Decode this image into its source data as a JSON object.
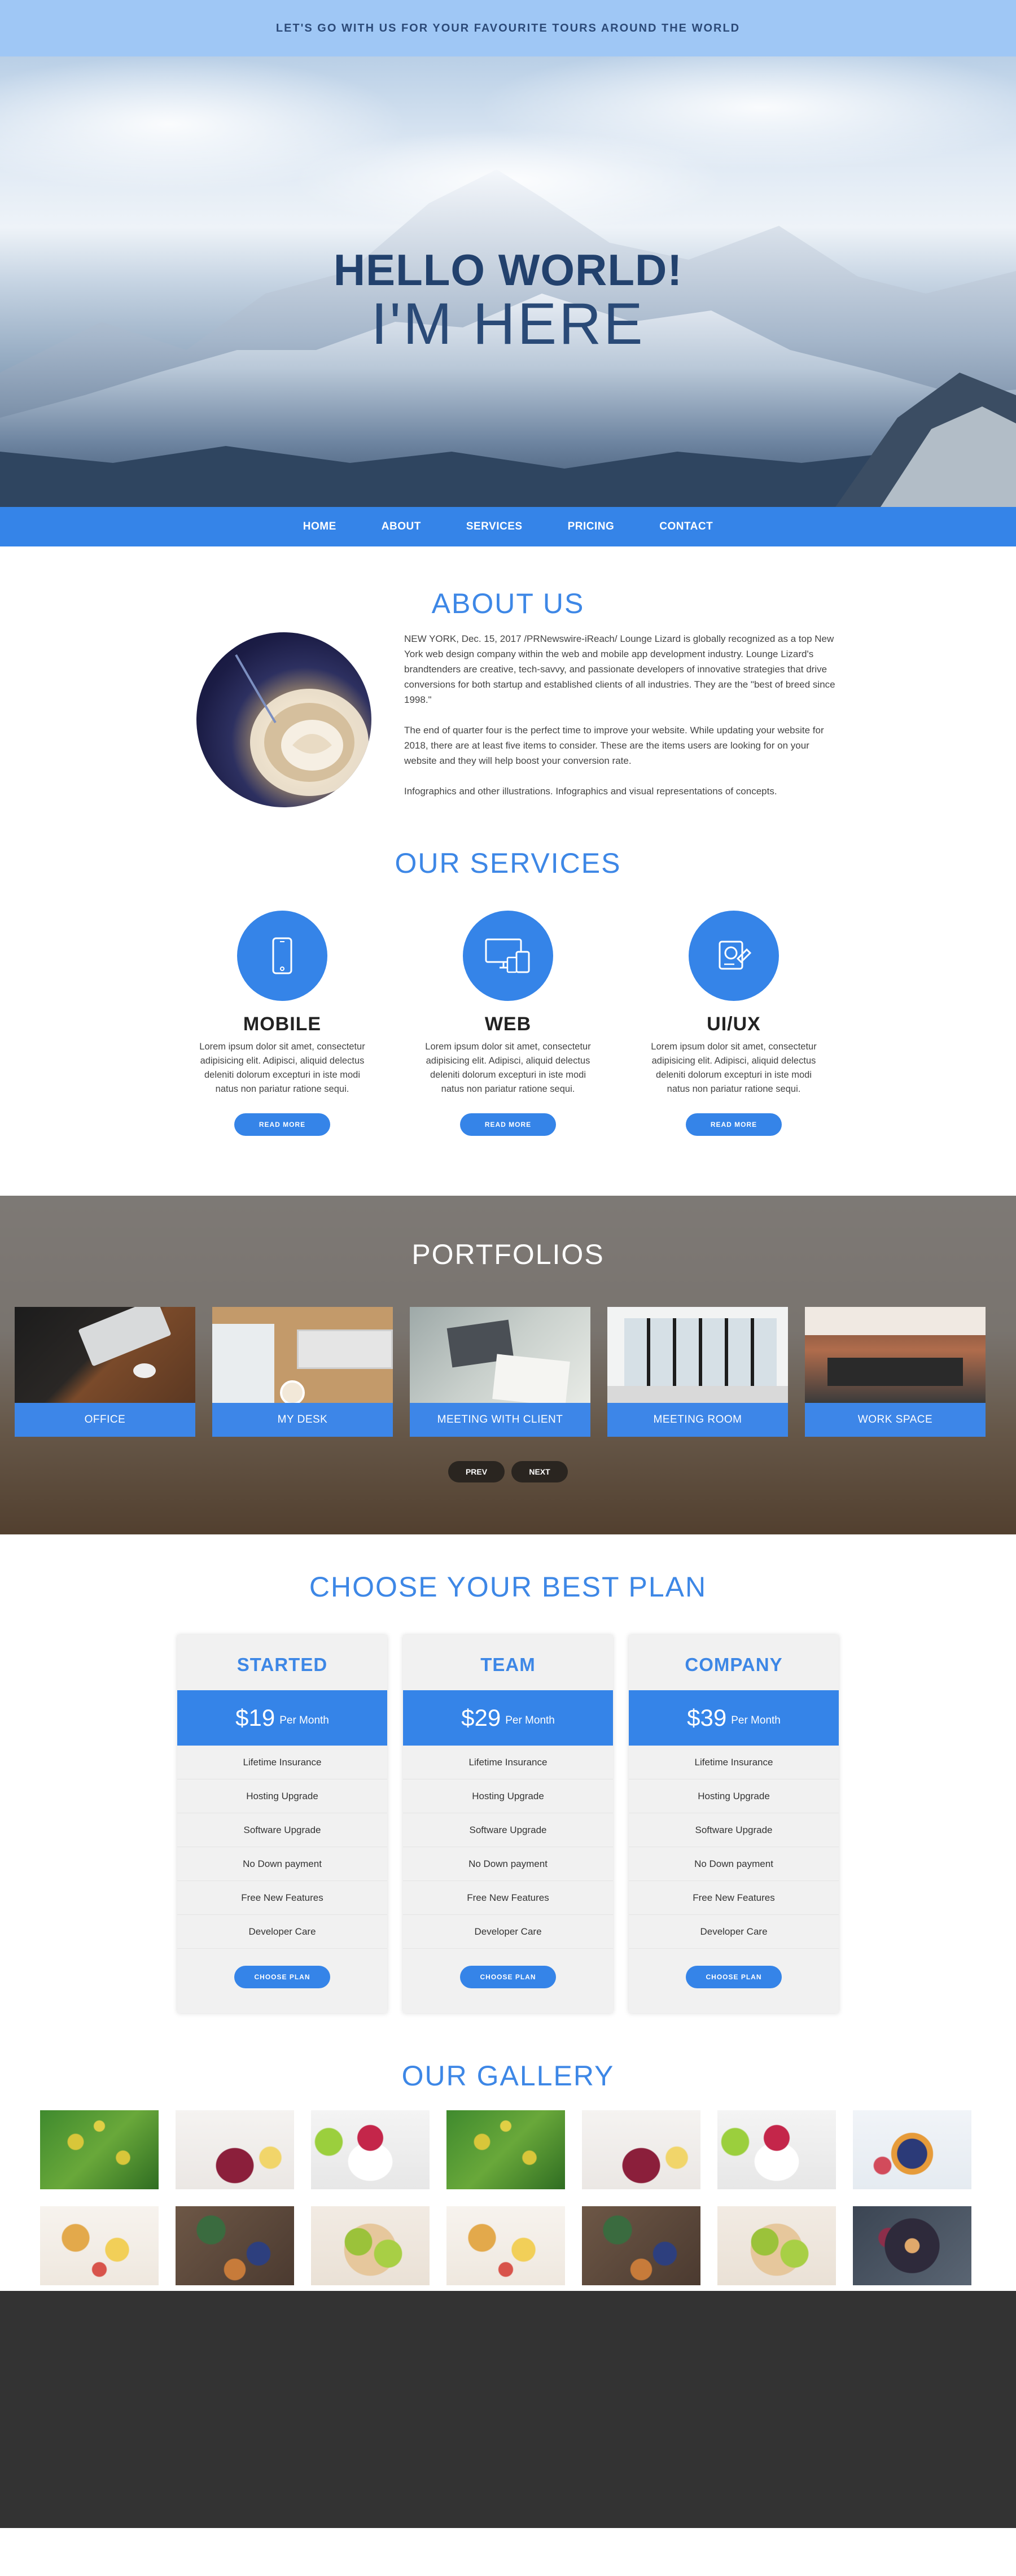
{
  "topbar": {
    "tagline": "LET'S GO WITH US FOR YOUR FAVOURITE TOURS AROUND THE WORLD"
  },
  "hero": {
    "line1": "HELLO WORLD!",
    "line2": "I'M HERE"
  },
  "nav": {
    "items": [
      "HOME",
      "ABOUT",
      "SERVICES",
      "PRICING",
      "CONTACT"
    ]
  },
  "about": {
    "title": "ABOUT US",
    "paragraphs": [
      "NEW YORK, Dec. 15, 2017 /PRNewswire-iReach/ Lounge Lizard is globally recognized as a top New York web design company within the web and mobile app development industry. Lounge Lizard's brandtenders are creative, tech-savvy, and passionate developers of innovative strategies that drive conversions for both startup and established clients of all industries. They are the \"best of breed since 1998.\"",
      "The end of quarter four is the perfect time to improve your website. While updating your website for 2018, there are at least five items to consider. These are the items users are looking for on your website and they will help boost your conversion rate.",
      "Infographics and other illustrations. Infographics and visual representations of concepts."
    ]
  },
  "services": {
    "title": "OUR SERVICES",
    "items": [
      {
        "name": "MOBILE",
        "icon": "smartphone-icon",
        "text": "Lorem ipsum dolor sit amet, consectetur adipisicing elit. Adipisci, aliquid delectus deleniti dolorum excepturi in iste modi natus non pariatur ratione sequi.",
        "button": "READ MORE"
      },
      {
        "name": "WEB",
        "icon": "devices-icon",
        "text": "Lorem ipsum dolor sit amet, consectetur adipisicing elit. Adipisci, aliquid delectus deleniti dolorum excepturi in iste modi natus non pariatur ratione sequi.",
        "button": "READ MORE"
      },
      {
        "name": "UI/UX",
        "icon": "design-icon",
        "text": "Lorem ipsum dolor sit amet, consectetur adipisicing elit. Adipisci, aliquid delectus deleniti dolorum excepturi in iste modi natus non pariatur ratione sequi.",
        "button": "READ MORE"
      }
    ]
  },
  "portfolio": {
    "title": "PORTFOLIOS",
    "items": [
      "OFFICE",
      "MY DESK",
      "MEETING WITH CLIENT",
      "MEETING ROOM",
      "WORK SPACE"
    ],
    "prev": "PREV",
    "next": "NEXT"
  },
  "pricing": {
    "title": "CHOOSE YOUR BEST PLAN",
    "plans": [
      {
        "name": "STARTED",
        "price": "$19",
        "period": "Per Month",
        "button": "CHOOSE PLAN"
      },
      {
        "name": "TEAM",
        "price": "$29",
        "period": "Per Month",
        "button": "CHOOSE PLAN"
      },
      {
        "name": "COMPANY",
        "price": "$39",
        "period": "Per Month",
        "button": "CHOOSE PLAN"
      }
    ],
    "features": [
      "Lifetime Insurance",
      "Hosting Upgrade",
      "Software Upgrade",
      "No Down payment",
      "Free New Features",
      "Developer Care"
    ]
  },
  "gallery": {
    "title": "OUR GALLERY"
  },
  "colors": {
    "accent": "#3584e8",
    "topbar": "#9fc7f5",
    "footer": "#333333"
  }
}
